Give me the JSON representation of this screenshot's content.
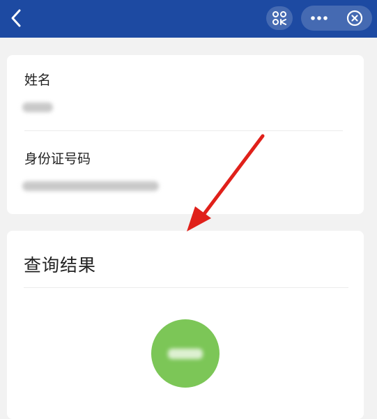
{
  "navbar": {
    "back_icon": "chevron-left-icon",
    "scan_icon": "scan-icon",
    "more_icon": "more-dots-icon",
    "close_icon": "close-circle-icon",
    "background_color": "#1d4aa2"
  },
  "form": {
    "name_label": "姓名",
    "id_label": "身份证号码"
  },
  "result": {
    "title": "查询结果",
    "status_color": "#7cc657"
  },
  "annotation": {
    "arrow_color": "#e0201a"
  }
}
